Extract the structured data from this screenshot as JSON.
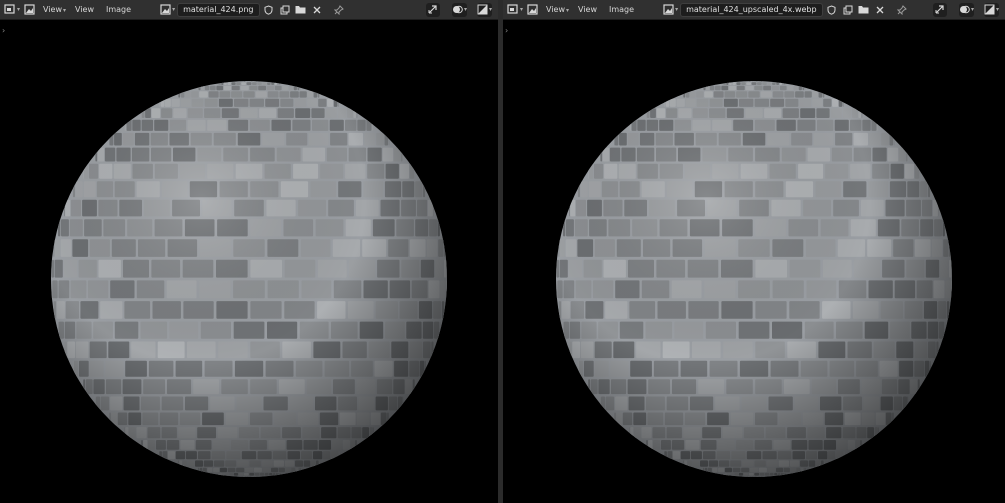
{
  "left_editor": {
    "view_menu": "View",
    "view_menu_2": "View",
    "image_menu": "Image",
    "image_name": "material_424.png"
  },
  "right_editor": {
    "view_menu": "View",
    "view_menu_2": "View",
    "image_menu": "Image",
    "image_name": "material_424_upscaled_4x.webp"
  },
  "icons": [
    "editor-type-icon",
    "view-mode-icon",
    "image-browse-icon",
    "shield-icon",
    "duplicate-icon",
    "folder-icon",
    "close-icon",
    "pin-icon",
    "gizmo-icon",
    "overlay-icon",
    "display-channels-icon",
    "collapse-arrow-icon"
  ],
  "colors": {
    "header_bg": "#303030",
    "viewport_bg": "#000000",
    "brick_light": "#c9cdd1",
    "brick_dark": "#6f7377"
  }
}
